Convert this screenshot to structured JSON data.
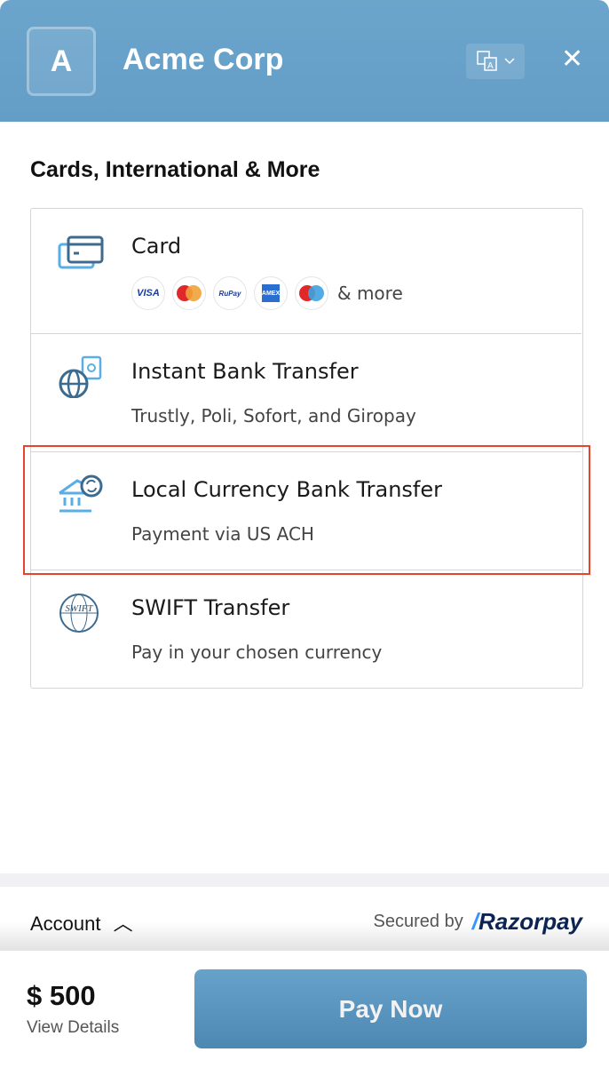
{
  "header": {
    "logo_letter": "A",
    "title": "Acme Corp",
    "language_icon": "translate-icon",
    "close_icon": "close-icon"
  },
  "section_title": "Cards, International & More",
  "methods": [
    {
      "title": "Card",
      "badges": [
        "VISA",
        "Mastercard",
        "RuPay",
        "AMEX",
        "Maestro"
      ],
      "more": "& more"
    },
    {
      "title": "Instant Bank Transfer",
      "subtitle": "Trustly, Poli, Sofort, and Giropay"
    },
    {
      "title": "Local Currency Bank Transfer",
      "subtitle": "Payment via US ACH",
      "highlighted": true
    },
    {
      "title": "SWIFT Transfer",
      "subtitle": "Pay in your chosen currency",
      "icon_text": "SWIFT"
    }
  ],
  "footer": {
    "account": "Account",
    "secured_by": "Secured by",
    "brand": "Razorpay",
    "amount": "$ 500",
    "view_details": "View Details",
    "pay_now": "Pay Now"
  },
  "colors": {
    "header": "#6ba5cc",
    "highlight": "#e8432e",
    "button": "#5a95c0"
  }
}
